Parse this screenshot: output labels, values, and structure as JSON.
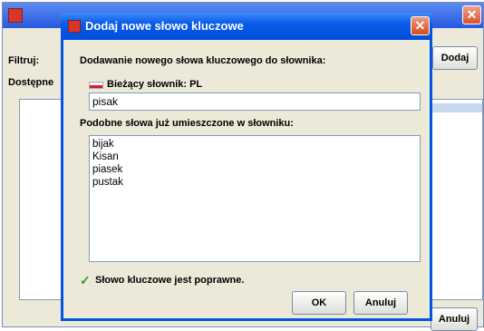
{
  "background_window": {
    "filter_label": "Filtruj:",
    "available_label": "Dostępne",
    "add_button": "Dodaj",
    "cancel_button": "Anuluj",
    "close_symbol": "✕"
  },
  "dialog": {
    "title": "Dodaj nowe słowo kluczowe",
    "close_symbol": "✕",
    "heading": "Dodawanie nowego słowa kluczowego do słownika:",
    "dictionary_label": "Bieżący słownik: PL",
    "input_value": "pisak",
    "similar_label": "Podobne słowa już umieszczone w słowniku:",
    "similar_words": [
      "bijak",
      "Kisan",
      "piasek",
      "pustak"
    ],
    "validation_symbol": "✓",
    "validation_message": "Słowo kluczowe jest poprawne.",
    "ok_button": "OK",
    "cancel_button": "Anuluj"
  }
}
